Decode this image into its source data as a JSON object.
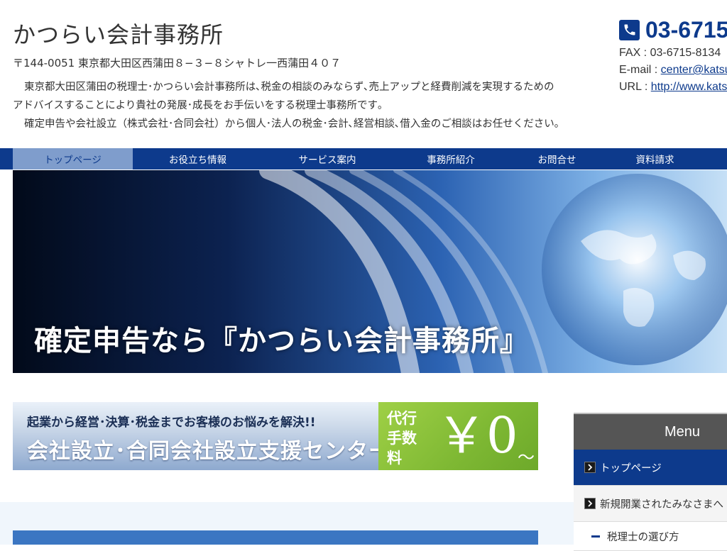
{
  "header": {
    "site_title": "かつらい会計事務所",
    "address": "〒144-0051 東京都大田区西蒲田８−３−８シャトレ一西蒲田４０７",
    "intro_line1": "東京都大田区蒲田の税理士･かつらい会計事務所は､税金の相談のみならず､売上アップと経費削減を実現するための",
    "intro_line2": "アドバイスすることにより貴社の発展･成長をお手伝いをする税理士事務所です｡",
    "intro_line3": "確定申告や会社設立（株式会社･合同会社）から個人･法人の税金･会計､経営相談､借入金のご相談はお任せください｡"
  },
  "contact": {
    "phone_icon": "phone-icon",
    "phone": "03-6715",
    "fax": "FAX : 03-6715-8134",
    "email_label": "E-mail : ",
    "email": "center@katsu",
    "url_label": "URL : ",
    "url": "http://www.kats"
  },
  "nav": {
    "items": [
      {
        "label": "トップページ",
        "active": true
      },
      {
        "label": "お役立ち情報"
      },
      {
        "label": "サービス案内"
      },
      {
        "label": "事務所紹介"
      },
      {
        "label": "お問合せ"
      },
      {
        "label": "資料請求"
      }
    ]
  },
  "hero": {
    "caption": "確定申告なら『かつらい会計事務所』"
  },
  "banner": {
    "top_text": "起業から経営･決算･税金までお客様のお悩みを解決!!",
    "main_text": "会社設立･合同会社設立支援センター",
    "fee_label_line1": "代行",
    "fee_label_line2": "手数料",
    "fee_value": "￥0",
    "fee_tilde": "〜"
  },
  "side_menu": {
    "title": "Menu",
    "items": [
      {
        "label": "トップページ"
      },
      {
        "label": "新規開業されたみなさまへ"
      },
      {
        "label": "税理士の選び方"
      }
    ]
  },
  "colors": {
    "brand_blue": "#0d3a8c",
    "nav_active": "#7f9dcc",
    "banner_green": "#7eb833",
    "menu_header": "#555555"
  }
}
